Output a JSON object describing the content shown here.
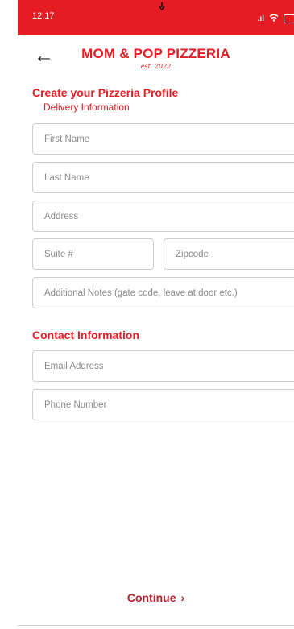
{
  "status_bar": {
    "time": "12:17",
    "signal": ".ıl",
    "wifi": "wifi-icon",
    "battery": "battery-icon"
  },
  "header": {
    "back_icon": "←",
    "brand": "MOM & POP PIZZERIA",
    "est": "est. 2022"
  },
  "form": {
    "title": "Create your Pizzeria Profile",
    "subtitle": "Delivery Information",
    "placeholders": {
      "first_name": "First Name",
      "last_name": "Last Name",
      "address": "Address",
      "suite": "Suite #",
      "zipcode": "Zipcode",
      "notes": "Additional Notes (gate code, leave at door etc.)",
      "email": "Email Address",
      "phone": "Phone Number"
    },
    "contact_section": "Contact Information",
    "continue_label": "Continue",
    "continue_chevron": "›"
  },
  "colors": {
    "accent": "#e51c23",
    "continue": "#b41e2e",
    "border": "#cfcfcf"
  }
}
